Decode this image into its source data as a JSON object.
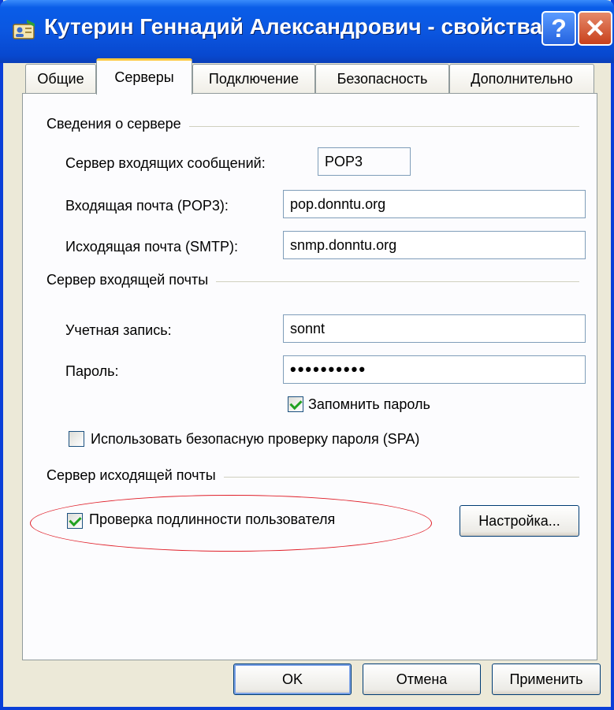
{
  "window": {
    "title": "Кутерин Геннадий Александрович - свойства",
    "help_glyph": "?",
    "close_glyph": "✕"
  },
  "tabs": [
    {
      "label": "Общие",
      "active": false
    },
    {
      "label": "Серверы",
      "active": true
    },
    {
      "label": "Подключение",
      "active": false
    },
    {
      "label": "Безопасность",
      "active": false
    },
    {
      "label": "Дополнительно",
      "active": false
    }
  ],
  "server_info": {
    "group_label": "Сведения о сервере",
    "incoming_type_label": "Сервер входящих сообщений:",
    "incoming_type_value": "POP3",
    "incoming_mail_label": "Входящая почта (POP3):",
    "incoming_mail_value": "pop.donntu.org",
    "outgoing_mail_label": "Исходящая почта (SMTP):",
    "outgoing_mail_value": "snmp.donntu.org"
  },
  "incoming_server": {
    "group_label": "Сервер входящей почты",
    "account_label": "Учетная запись:",
    "account_value": "sonnt",
    "password_label": "Пароль:",
    "password_value": "••••••••••",
    "remember_label": "Запомнить пароль",
    "remember_checked": true,
    "spa_label": "Использовать безопасную проверку пароля (SPA)",
    "spa_checked": false
  },
  "outgoing_server": {
    "group_label": "Сервер исходящей почты",
    "auth_label": "Проверка подлинности пользователя",
    "auth_checked": true,
    "settings_button": "Настройка..."
  },
  "buttons": {
    "ok": "OK",
    "cancel": "Отмена",
    "apply": "Применить"
  },
  "colors": {
    "titlebar": "#0B56E0",
    "dialog_bg": "#ECE9D8",
    "highlight_ellipse": "#E0202A",
    "check_mark": "#21A121"
  }
}
